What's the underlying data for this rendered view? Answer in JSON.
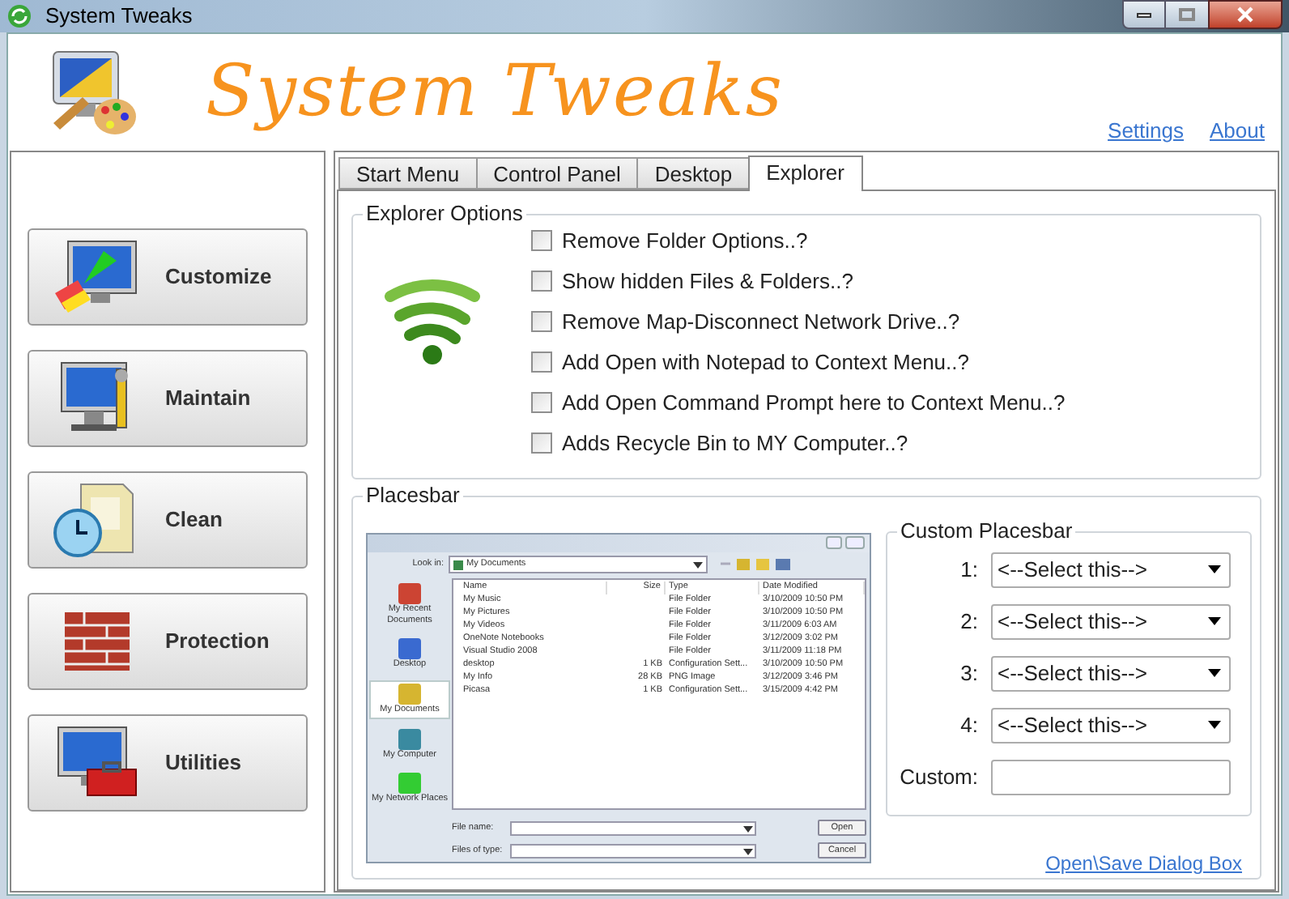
{
  "window": {
    "title": "System Tweaks"
  },
  "header": {
    "app_title": "System Tweaks",
    "links": [
      "Settings",
      "About"
    ]
  },
  "sidebar": {
    "buttons": [
      "Customize",
      "Maintain",
      "Clean",
      "Protection",
      "Utilities"
    ]
  },
  "tabs": [
    {
      "label": "Start Menu",
      "selected": false
    },
    {
      "label": "Control Panel",
      "selected": false
    },
    {
      "label": "Desktop",
      "selected": false
    },
    {
      "label": "Explorer",
      "selected": true
    }
  ],
  "explorer_options": {
    "title": "Explorer Options",
    "options": [
      {
        "label": "Remove Folder Options..?",
        "checked": false
      },
      {
        "label": "Show hidden Files & Folders..?",
        "checked": false
      },
      {
        "label": "Remove Map-Disconnect Network Drive..?",
        "checked": false
      },
      {
        "label": "Add Open with Notepad to Context Menu..?",
        "checked": false
      },
      {
        "label": "Add Open Command Prompt here to Context Menu..?",
        "checked": false
      },
      {
        "label": "Adds Recycle Bin to MY Computer..?",
        "checked": false
      }
    ]
  },
  "placesbar": {
    "title": "Placesbar",
    "preview": {
      "look_in_label": "Look in:",
      "look_in_value": "My Documents",
      "places": [
        {
          "label": "My Recent Documents",
          "selected": false
        },
        {
          "label": "Desktop",
          "selected": false
        },
        {
          "label": "My Documents",
          "selected": true
        },
        {
          "label": "My Computer",
          "selected": false
        },
        {
          "label": "My Network Places",
          "selected": false
        }
      ],
      "columns": [
        "Name",
        "Size",
        "Type",
        "Date Modified"
      ],
      "rows": [
        {
          "name": "My Music",
          "size": "",
          "type": "File Folder",
          "date": "3/10/2009 10:50 PM"
        },
        {
          "name": "My Pictures",
          "size": "",
          "type": "File Folder",
          "date": "3/10/2009 10:50 PM"
        },
        {
          "name": "My Videos",
          "size": "",
          "type": "File Folder",
          "date": "3/11/2009 6:03 AM"
        },
        {
          "name": "OneNote Notebooks",
          "size": "",
          "type": "File Folder",
          "date": "3/12/2009 3:02 PM"
        },
        {
          "name": "Visual Studio 2008",
          "size": "",
          "type": "File Folder",
          "date": "3/11/2009 11:18 PM"
        },
        {
          "name": "desktop",
          "size": "1 KB",
          "type": "Configuration Sett...",
          "date": "3/10/2009 10:50 PM"
        },
        {
          "name": "My Info",
          "size": "28 KB",
          "type": "PNG Image",
          "date": "3/12/2009 3:46 PM"
        },
        {
          "name": "Picasa",
          "size": "1 KB",
          "type": "Configuration Sett...",
          "date": "3/15/2009 4:42 PM"
        }
      ],
      "file_name_label": "File name:",
      "files_of_type_label": "Files of type:",
      "buttons": [
        "Open",
        "Cancel"
      ]
    },
    "custom_placesbar": {
      "title": "Custom Placesbar",
      "slots": [
        {
          "label": "1:",
          "value": "<--Select this-->"
        },
        {
          "label": "2:",
          "value": "<--Select this-->"
        },
        {
          "label": "3:",
          "value": "<--Select this-->"
        },
        {
          "label": "4:",
          "value": "<--Select this-->"
        }
      ],
      "custom_label": "Custom:"
    },
    "link": "Open\\Save Dialog Box"
  }
}
